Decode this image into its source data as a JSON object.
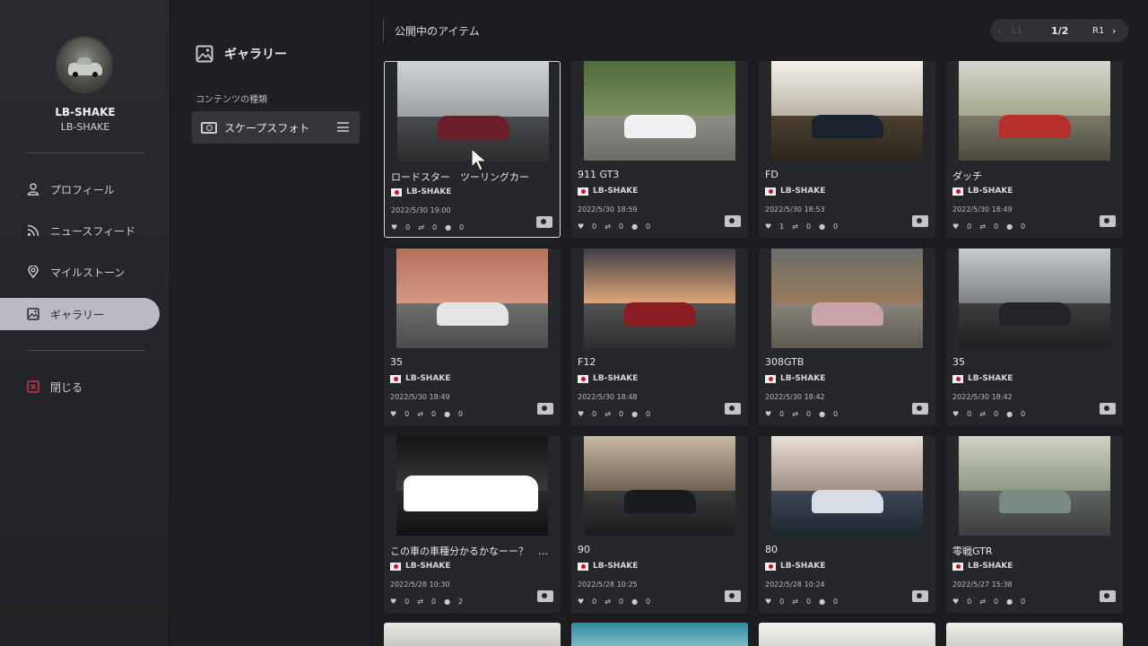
{
  "user": {
    "name": "LB-SHAKE",
    "id": "LB-SHAKE"
  },
  "nav": [
    {
      "label": "プロフィール",
      "icon": "person-icon"
    },
    {
      "label": "ニュースフィード",
      "icon": "rss-icon"
    },
    {
      "label": "マイルストーン",
      "icon": "location-pin-icon"
    },
    {
      "label": "ギャラリー",
      "icon": "gallery-icon",
      "active": true
    }
  ],
  "close_label": "閉じる",
  "gallery": {
    "title": "ギャラリー",
    "content_type_label": "コンテンツの種類",
    "filter_label": "スケープスフォト"
  },
  "main": {
    "title": "公開中のアイテム",
    "pager": {
      "prev": "‹",
      "l1": "L1",
      "page": "1/2",
      "r1": "R1",
      "next": "›"
    }
  },
  "items": [
    {
      "title": "ロードスター　ツーリングカー",
      "owner": "LB-SHAKE",
      "date": "2022/5/30 19:00",
      "likes": "0",
      "reposts": "0",
      "comments": "0"
    },
    {
      "title": "911 GT3",
      "owner": "LB-SHAKE",
      "date": "2022/5/30 18:59",
      "likes": "0",
      "reposts": "0",
      "comments": "0"
    },
    {
      "title": "FD",
      "owner": "LB-SHAKE",
      "date": "2022/5/30 18:53",
      "likes": "1",
      "reposts": "0",
      "comments": "0"
    },
    {
      "title": "ダッチ",
      "owner": "LB-SHAKE",
      "date": "2022/5/30 18:49",
      "likes": "0",
      "reposts": "0",
      "comments": "0"
    },
    {
      "title": "35",
      "owner": "LB-SHAKE",
      "date": "2022/5/30 18:49",
      "likes": "0",
      "reposts": "0",
      "comments": "0"
    },
    {
      "title": "F12",
      "owner": "LB-SHAKE",
      "date": "2022/5/30 18:48",
      "likes": "0",
      "reposts": "0",
      "comments": "0"
    },
    {
      "title": "308GTB",
      "owner": "LB-SHAKE",
      "date": "2022/5/30 18:42",
      "likes": "0",
      "reposts": "0",
      "comments": "0"
    },
    {
      "title": "35",
      "owner": "LB-SHAKE",
      "date": "2022/5/30 18:42",
      "likes": "0",
      "reposts": "0",
      "comments": "0"
    },
    {
      "title": "この車の車種分かるかなーー？　わかっ...",
      "owner": "LB-SHAKE",
      "date": "2022/5/28 10:30",
      "likes": "0",
      "reposts": "0",
      "comments": "2"
    },
    {
      "title": "90",
      "owner": "LB-SHAKE",
      "date": "2022/5/28 10:25",
      "likes": "0",
      "reposts": "0",
      "comments": "0"
    },
    {
      "title": "80",
      "owner": "LB-SHAKE",
      "date": "2022/5/28 10:24",
      "likes": "0",
      "reposts": "0",
      "comments": "0"
    },
    {
      "title": "零戦GTR",
      "owner": "LB-SHAKE",
      "date": "2022/5/27 15:38",
      "likes": "0",
      "reposts": "0",
      "comments": "0"
    }
  ],
  "colors": {
    "accent_active": "#b9bac3",
    "close_icon": "#d0314a",
    "flag_red": "#c8102e"
  }
}
